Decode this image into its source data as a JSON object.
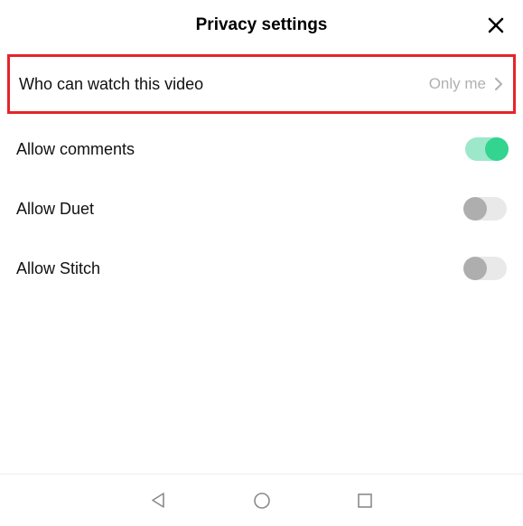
{
  "header": {
    "title": "Privacy settings"
  },
  "rows": {
    "privacy": {
      "label": "Who can watch this video",
      "value": "Only me"
    },
    "comments": {
      "label": "Allow comments",
      "on": true
    },
    "duet": {
      "label": "Allow Duet",
      "on": false
    },
    "stitch": {
      "label": "Allow Stitch",
      "on": false
    }
  }
}
